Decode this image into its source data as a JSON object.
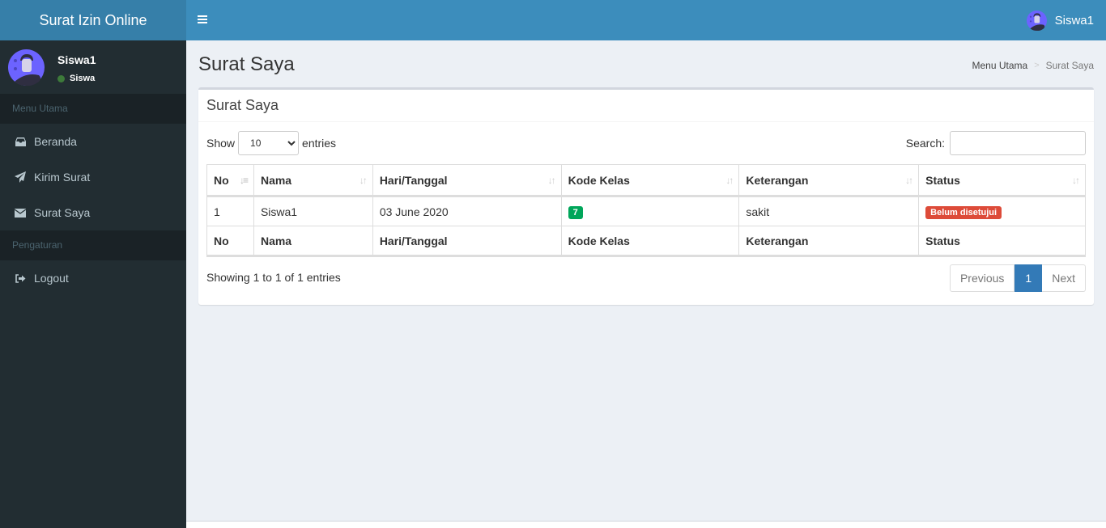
{
  "app": {
    "title": "Surat Izin Online"
  },
  "navbar": {
    "user_name": "Siswa1"
  },
  "sidebar": {
    "user": {
      "name": "Siswa1",
      "status": "Siswa",
      "status_color": "#3d7a3a"
    },
    "sections": [
      {
        "header": "Menu Utama",
        "items": [
          {
            "label": "Beranda",
            "icon": "inbox-icon"
          },
          {
            "label": "Kirim Surat",
            "icon": "paper-plane-icon"
          },
          {
            "label": "Surat Saya",
            "icon": "envelope-icon"
          }
        ]
      },
      {
        "header": "Pengaturan",
        "items": [
          {
            "label": "Logout",
            "icon": "sign-out-icon"
          }
        ]
      }
    ]
  },
  "content": {
    "page_title": "Surat Saya",
    "breadcrumb": [
      "Menu Utama",
      "Surat Saya"
    ],
    "box_title": "Surat Saya",
    "length": {
      "show_label": "Show",
      "value": "10",
      "entries_label": "entries"
    },
    "search": {
      "label": "Search:",
      "value": ""
    },
    "table": {
      "columns": [
        "No",
        "Nama",
        "Hari/Tanggal",
        "Kode Kelas",
        "Keterangan",
        "Status"
      ],
      "rows": [
        {
          "no": "1",
          "nama": "Siswa1",
          "tanggal": "03 June 2020",
          "kode_kelas": "7",
          "keterangan": "sakit",
          "status": "Belum disetujui"
        }
      ]
    },
    "info": "Showing 1 to 1 of 1 entries",
    "pagination": {
      "previous": "Previous",
      "current": "1",
      "next": "Next"
    }
  },
  "colors": {
    "brand": "#3c8dbc",
    "logo_bg": "#367fa9",
    "sidebar_bg": "#222d32",
    "success": "#00a65a",
    "danger": "#dd4b39",
    "primary": "#337ab7"
  }
}
